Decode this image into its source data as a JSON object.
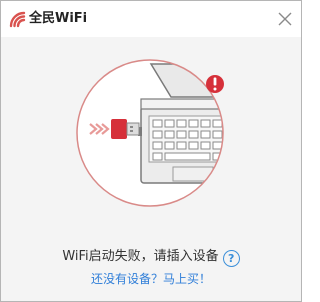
{
  "window": {
    "title": "全民WiFi"
  },
  "icons": {
    "logo": "wifi-logo-icon",
    "close": "close-icon",
    "alert": "exclamation-icon",
    "help": "question-icon",
    "usb": "usb-wifi-adapter-icon",
    "laptop": "laptop-icon",
    "arrows": "double-chevron-right-icon"
  },
  "colors": {
    "brand_red": "#d9534f",
    "alert_red": "#d6303a",
    "link_blue": "#2f7ed8"
  },
  "status": {
    "message": "WiFi启动失败，请插入设备",
    "help_symbol": "?"
  },
  "links": {
    "buy_device": "还没有设备？马上买！"
  }
}
